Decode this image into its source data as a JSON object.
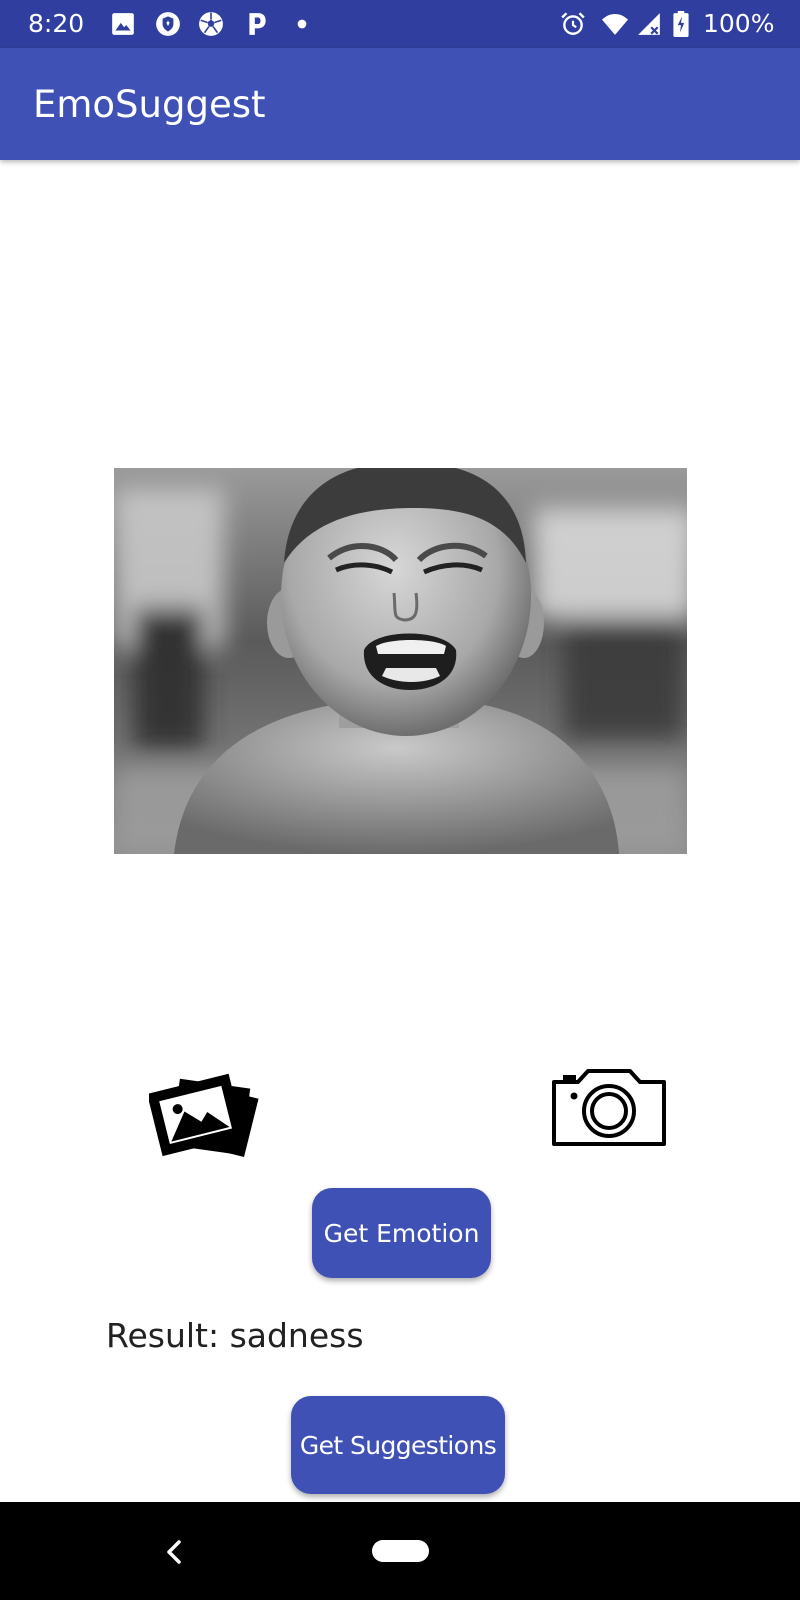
{
  "status_bar": {
    "time": "8:20",
    "battery_percent": "100%",
    "notification_icons": [
      "image-icon",
      "shield-icon",
      "soccer-ball-icon",
      "p-icon",
      "dot-icon"
    ],
    "system_icons": [
      "alarm-icon",
      "wifi-icon",
      "signal-icon",
      "battery-icon"
    ]
  },
  "app_bar": {
    "title": "EmoSuggest",
    "color": "#3f51b5"
  },
  "photo": {
    "subject": "crying child, black and white"
  },
  "actions": {
    "gallery_icon": "gallery-icon",
    "camera_icon": "camera-icon"
  },
  "buttons": {
    "get_emotion": "Get Emotion",
    "get_suggestions": "Get Suggestions"
  },
  "result": {
    "text": "Result: sadness"
  },
  "nav_bar": {
    "back_icon": "back-chevron-icon",
    "home_icon": "home-pill-icon"
  }
}
